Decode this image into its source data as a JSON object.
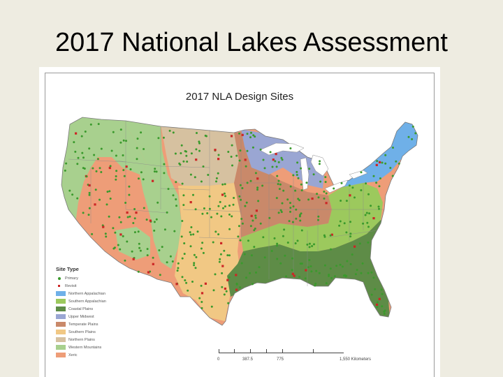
{
  "slide": {
    "title": "2017 National Lakes Assessment"
  },
  "map": {
    "title": "2017 NLA Design Sites",
    "legend": {
      "title": "Site Type",
      "site_types": [
        {
          "label": "Primary",
          "color": "#3a9a2c",
          "shape": "circle"
        },
        {
          "label": "Revisit",
          "color": "#cc2626",
          "shape": "square"
        }
      ],
      "ecoregions": [
        {
          "label": "Northern Appalachian",
          "color": "#6fb0e8"
        },
        {
          "label": "Southern Appalachian",
          "color": "#9cc95d"
        },
        {
          "label": "Coastal Plains",
          "color": "#5e8c47"
        },
        {
          "label": "Upper Midwest",
          "color": "#9aa6d3"
        },
        {
          "label": "Temperate Plains",
          "color": "#c9896a"
        },
        {
          "label": "Southern Plains",
          "color": "#f1c884"
        },
        {
          "label": "Northern Plains",
          "color": "#d6c1a0"
        },
        {
          "label": "Western Mountains",
          "color": "#a8d08e"
        },
        {
          "label": "Xeric",
          "color": "#ee9d78"
        }
      ]
    },
    "scale": {
      "ticks": [
        "0",
        "387.5",
        "775",
        "1,550 Kilometers"
      ]
    }
  }
}
